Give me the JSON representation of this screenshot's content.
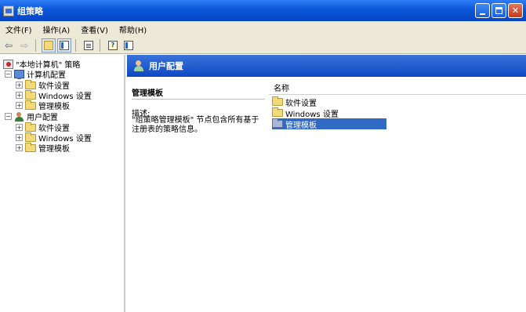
{
  "window": {
    "title": "组策略"
  },
  "menu": [
    {
      "label": "文件(F)"
    },
    {
      "label": "操作(A)"
    },
    {
      "label": "查看(V)"
    },
    {
      "label": "帮助(H)"
    }
  ],
  "toolbar": {
    "back": "⇦",
    "forward": "⇨"
  },
  "tree": {
    "root": "\"本地计算机\" 策略",
    "computer_config": "计算机配置",
    "computer_children": [
      "软件设置",
      "Windows 设置",
      "管理模板"
    ],
    "user_config": "用户配置",
    "user_children": [
      "软件设置",
      "Windows 设置",
      "管理模板"
    ]
  },
  "right": {
    "header": "用户配置",
    "desc_title": "管理模板",
    "desc_label": "描述:",
    "desc_text": "\"组策略管理模板\" 节点包含所有基于注册表的策略信息。",
    "column_name": "名称",
    "items": [
      "软件设置",
      "Windows 设置",
      "管理模板"
    ],
    "selected_index": 2
  }
}
